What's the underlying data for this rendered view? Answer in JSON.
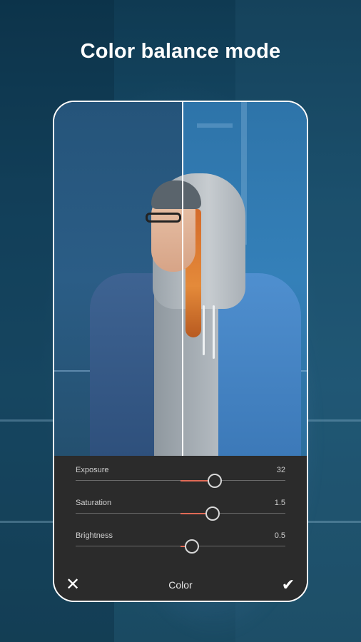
{
  "headline": "Color balance mode",
  "editor": {
    "sliders": [
      {
        "label": "Exposure",
        "value": "32",
        "min": -100,
        "max": 100,
        "current": 32
      },
      {
        "label": "Saturation",
        "value": "1.5",
        "min": -5,
        "max": 5,
        "current": 1.5
      },
      {
        "label": "Brightness",
        "value": "0.5",
        "min": -5,
        "max": 5,
        "current": 0.5
      }
    ],
    "mode_label": "Color",
    "cancel_icon": "close-icon",
    "confirm_icon": "checkmark-icon"
  },
  "colors": {
    "accent": "#e06a56",
    "panel": "#2b2b2b",
    "frame": "#ffffff"
  }
}
